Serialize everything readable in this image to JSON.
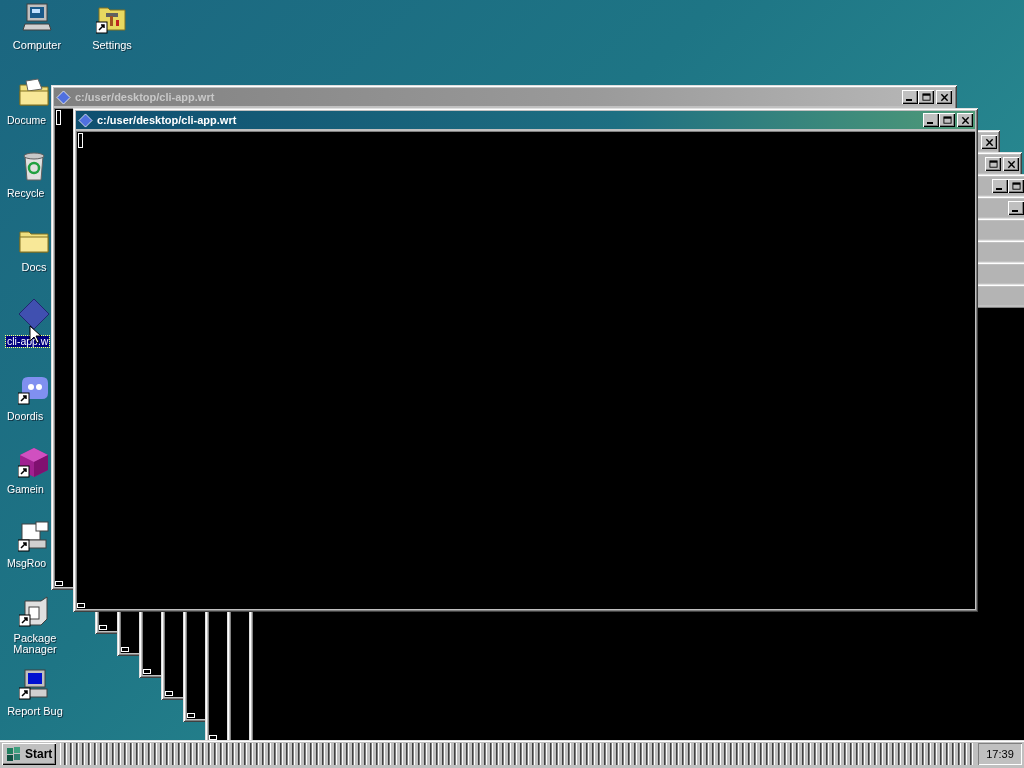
{
  "desktop_icons": [
    {
      "label": "Computer",
      "kind": "computer",
      "shortcut": false,
      "selected": false
    },
    {
      "label": "Settings",
      "kind": "settings",
      "shortcut": true,
      "selected": false
    },
    {
      "label": "Docume",
      "kind": "documents",
      "shortcut": false,
      "selected": false
    },
    {
      "label": "Recycle",
      "kind": "recycle",
      "shortcut": false,
      "selected": false
    },
    {
      "label": "Docs",
      "kind": "folder",
      "shortcut": false,
      "selected": false
    },
    {
      "label": "cli-app.w",
      "kind": "app",
      "shortcut": false,
      "selected": true
    },
    {
      "label": "Doordis",
      "kind": "chat",
      "shortcut": true,
      "selected": false
    },
    {
      "label": "Gamein",
      "kind": "cube",
      "shortcut": true,
      "selected": false
    },
    {
      "label": "MsgRoo",
      "kind": "messenger",
      "shortcut": true,
      "selected": false
    },
    {
      "label": "Package Manager",
      "kind": "package",
      "shortcut": true,
      "selected": false
    },
    {
      "label": "Report Bug",
      "kind": "monitor",
      "shortcut": true,
      "selected": false
    }
  ],
  "windows": [
    {
      "title": "c:/user/desktop/cli-app.wrt",
      "active": false
    },
    {
      "title": "c:/user/desktop/cli-app.wrt",
      "active": true
    }
  ],
  "taskbar": {
    "start_label": "Start",
    "clock": "17:39"
  }
}
